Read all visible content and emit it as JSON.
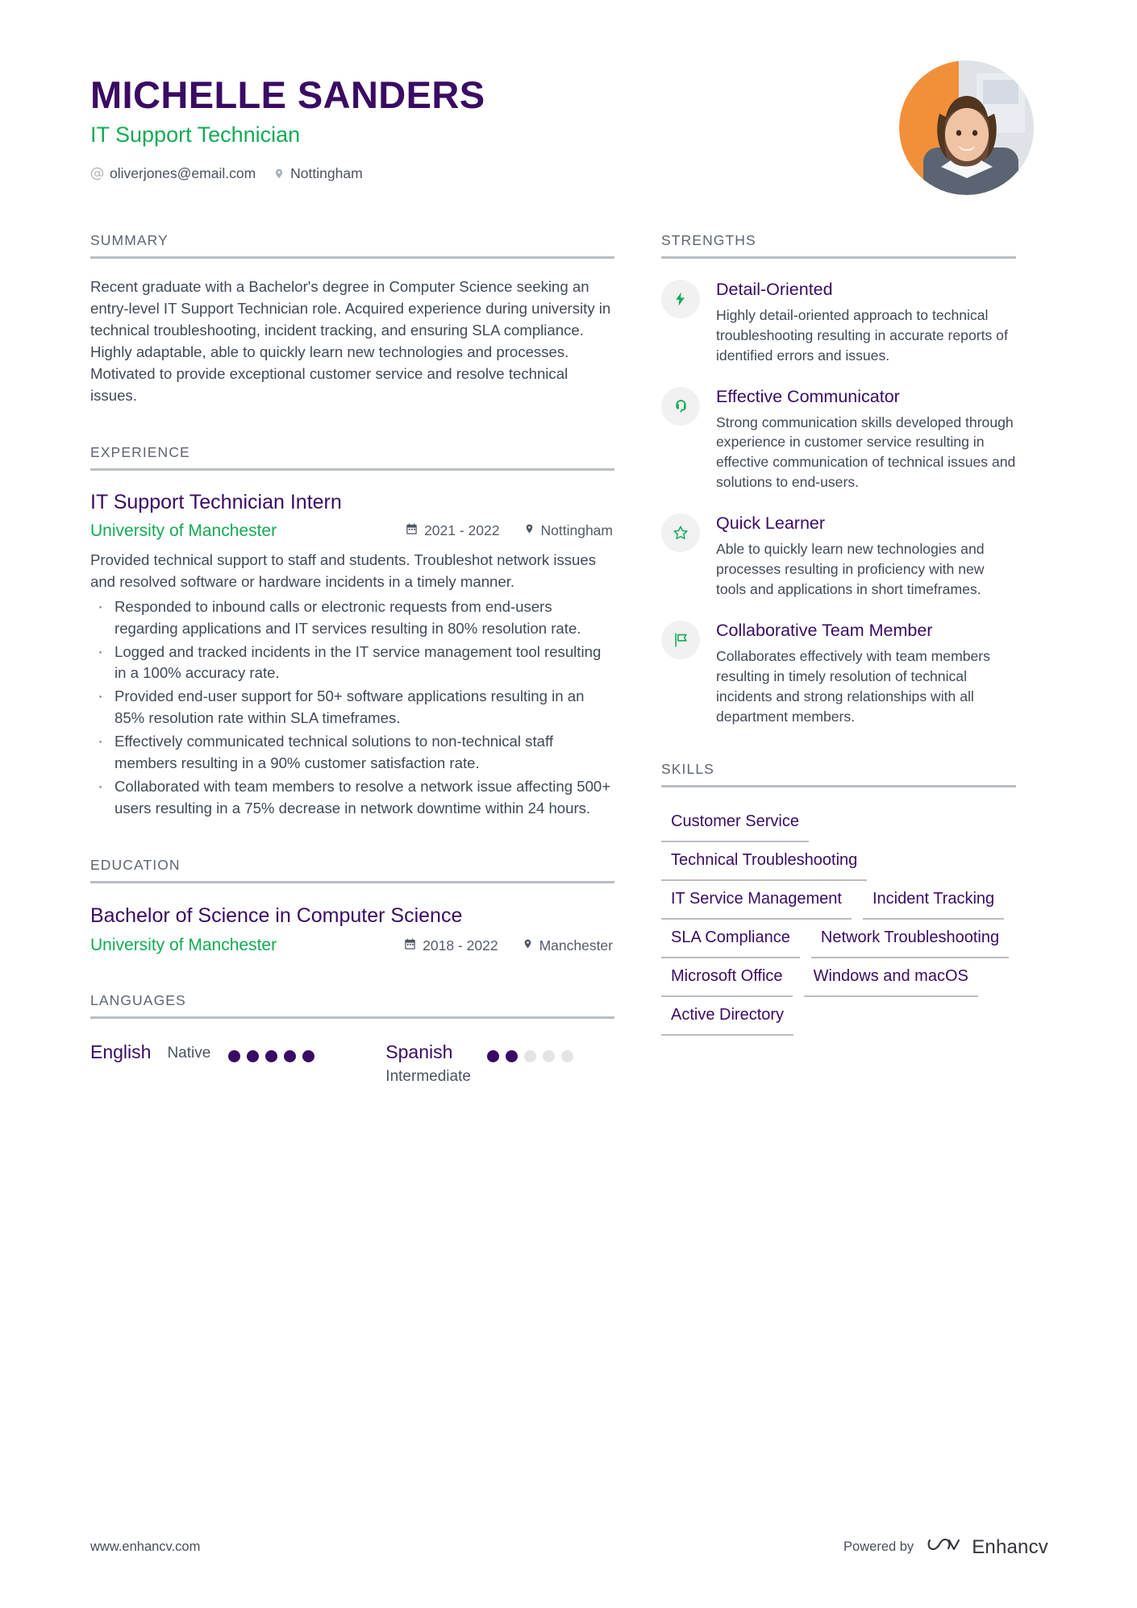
{
  "header": {
    "full_name": "MICHELLE SANDERS",
    "job_title": "IT Support Technician",
    "email": "oliverjones@email.com",
    "location": "Nottingham",
    "email_icon": "at-sign-icon",
    "location_icon": "map-pin-icon"
  },
  "colors": {
    "primary_purple": "#3a0b63",
    "accent_green": "#12ab54",
    "body_text": "#404a57",
    "rule_grey": "#b9bdc4"
  },
  "summary": {
    "heading": "SUMMARY",
    "text": "Recent graduate with a Bachelor's degree in Computer Science seeking an entry-level IT Support Technician role. Acquired experience during university in technical troubleshooting, incident tracking, and ensuring SLA compliance. Highly adaptable, able to quickly learn new technologies and processes. Motivated to provide exceptional customer service and resolve technical issues."
  },
  "experience": {
    "heading": "EXPERIENCE",
    "items": [
      {
        "title": "IT Support Technician Intern",
        "company": "University of Manchester",
        "dates": "2021 - 2022",
        "location": "Nottingham",
        "description": "Provided technical support to staff and students. Troubleshot network issues and resolved software or hardware incidents in a timely manner.",
        "bullets": [
          "Responded to inbound calls or electronic requests from end-users regarding applications and IT services resulting in 80% resolution rate.",
          "Logged and tracked incidents in the IT service management tool resulting in a 100% accuracy rate.",
          "Provided end-user support for 50+ software applications resulting in an 85% resolution rate within SLA timeframes.",
          "Effectively communicated technical solutions to non-technical staff members resulting in a 90% customer satisfaction rate.",
          "Collaborated with team members to resolve a network issue affecting 500+ users resulting in a 75% decrease in network downtime within 24 hours."
        ]
      }
    ]
  },
  "education": {
    "heading": "EDUCATION",
    "items": [
      {
        "degree": "Bachelor of Science in Computer Science",
        "school": "University of Manchester",
        "dates": "2018 - 2022",
        "location": "Manchester"
      }
    ]
  },
  "languages": {
    "heading": "LANGUAGES",
    "items": [
      {
        "name": "English",
        "level": "Native",
        "rating": 5,
        "max": 5
      },
      {
        "name": "Spanish",
        "level": "Intermediate",
        "rating": 2,
        "max": 5
      }
    ]
  },
  "strengths": {
    "heading": "STRENGTHS",
    "items": [
      {
        "icon": "lightning-bolt-icon",
        "name": "Detail-Oriented",
        "description": "Highly detail-oriented approach to technical troubleshooting resulting in accurate reports of identified errors and issues."
      },
      {
        "icon": "speech-bubble-icon",
        "name": "Effective Communicator",
        "description": "Strong communication skills developed through experience in customer service resulting in effective communication of technical issues and solutions to end-users."
      },
      {
        "icon": "star-icon",
        "name": "Quick Learner",
        "description": "Able to quickly learn new technologies and processes resulting in proficiency with new tools and applications in short timeframes."
      },
      {
        "icon": "flag-icon",
        "name": "Collaborative Team Member",
        "description": "Collaborates effectively with team members resulting in timely resolution of technical incidents and strong relationships with all department members."
      }
    ]
  },
  "skills": {
    "heading": "SKILLS",
    "items": [
      "Customer Service",
      "Technical Troubleshooting",
      "IT Service Management",
      "Incident Tracking",
      "SLA Compliance",
      "Network Troubleshooting",
      "Microsoft Office",
      "Windows and macOS",
      "Active Directory"
    ]
  },
  "footer": {
    "url": "www.enhancv.com",
    "powered_by": "Powered by",
    "brand": "Enhancv"
  }
}
